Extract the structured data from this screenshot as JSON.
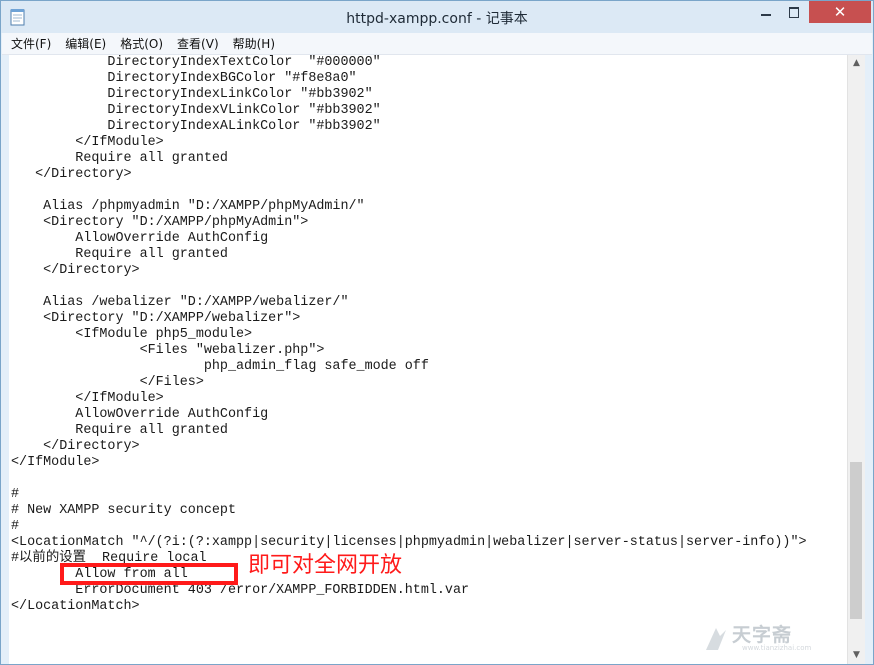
{
  "window": {
    "title": "httpd-xampp.conf - 记事本",
    "close_glyph": "✕"
  },
  "menu": [
    {
      "label": "文件(F)"
    },
    {
      "label": "编辑(E)"
    },
    {
      "label": "格式(O)"
    },
    {
      "label": "查看(V)"
    },
    {
      "label": "帮助(H)"
    }
  ],
  "editor": {
    "lines": [
      "            DirectoryIndexTextColor  \"#000000\"",
      "            DirectoryIndexBGColor \"#f8e8a0\"",
      "            DirectoryIndexLinkColor \"#bb3902\"",
      "            DirectoryIndexVLinkColor \"#bb3902\"",
      "            DirectoryIndexALinkColor \"#bb3902\"",
      "        </IfModule>",
      "        Require all granted",
      "   </Directory>",
      "",
      "    Alias /phpmyadmin \"D:/XAMPP/phpMyAdmin/\"",
      "    <Directory \"D:/XAMPP/phpMyAdmin\">",
      "        AllowOverride AuthConfig",
      "        Require all granted",
      "    </Directory>",
      "",
      "    Alias /webalizer \"D:/XAMPP/webalizer/\"",
      "    <Directory \"D:/XAMPP/webalizer\">",
      "        <IfModule php5_module>",
      "                <Files \"webalizer.php\">",
      "                        php_admin_flag safe_mode off",
      "                </Files>",
      "        </IfModule>",
      "        AllowOverride AuthConfig",
      "        Require all granted",
      "    </Directory>",
      "</IfModule>",
      "",
      "#",
      "# New XAMPP security concept",
      "#",
      "<LocationMatch \"^/(?i:(?:xampp|security|licenses|phpmyadmin|webalizer|server-status|server-info))\">",
      "#以前的设置  Require local",
      "        Allow from all",
      "        ErrorDocument 403 /error/XAMPP_FORBIDDEN.html.var",
      "</LocationMatch>"
    ]
  },
  "annotation": {
    "text": "即可对全网开放",
    "color": "#ff1a1a"
  },
  "scrollbar": {
    "up_glyph": "▲",
    "down_glyph": "▼"
  },
  "watermark": {
    "text": "天字斋",
    "sub": "www.tianzizhai.com"
  }
}
